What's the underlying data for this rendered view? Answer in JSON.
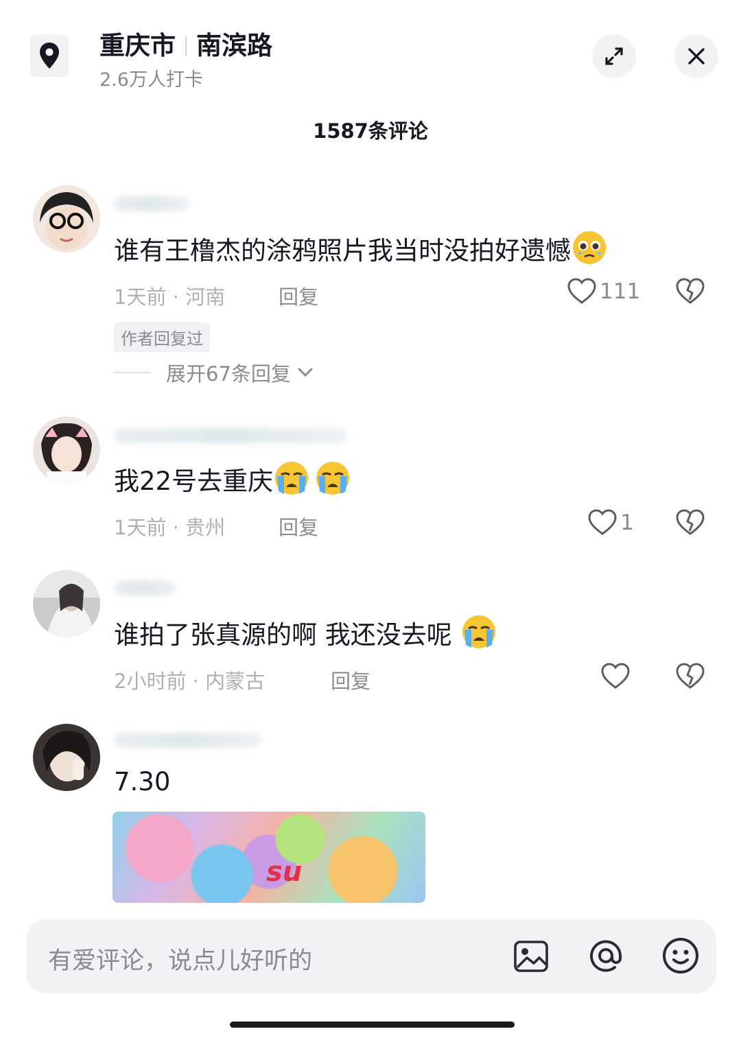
{
  "location": {
    "city": "重庆市",
    "street": "南滨路",
    "checkins": "2.6万人打卡",
    "pin_icon": "location-pin-icon",
    "expand_icon": "expand-icon",
    "close_icon": "close-icon"
  },
  "comment_count": "1587条评论",
  "comments": [
    {
      "text": "谁有王橹杰的涂鸦照片我当时没拍好遗憾",
      "emoji": "pleading-face-emoji",
      "time": "1天前",
      "region": "河南",
      "reply_label": "回复",
      "likes": "111",
      "author_tag": "作者回复过",
      "expand_replies": "展开67条回复"
    },
    {
      "text": "我22号去重庆",
      "emoji": "crying-face-emoji",
      "time": "1天前",
      "region": "贵州",
      "reply_label": "回复",
      "likes": "1"
    },
    {
      "text": "谁拍了张真源的啊 我还没去呢",
      "emoji": "crying-face-emoji",
      "time": "2小时前",
      "region": "内蒙古",
      "reply_label": "回复",
      "likes": ""
    },
    {
      "text": "7.30",
      "photo_text": "su"
    }
  ],
  "input": {
    "placeholder": "有爱评论，说点儿好听的",
    "image_icon": "image-icon",
    "at_icon": "at-icon",
    "emoji_icon": "smiley-icon"
  },
  "colors": {
    "text": "#161823",
    "muted": "#8a8b91",
    "input_bg": "#f2f2f4"
  }
}
